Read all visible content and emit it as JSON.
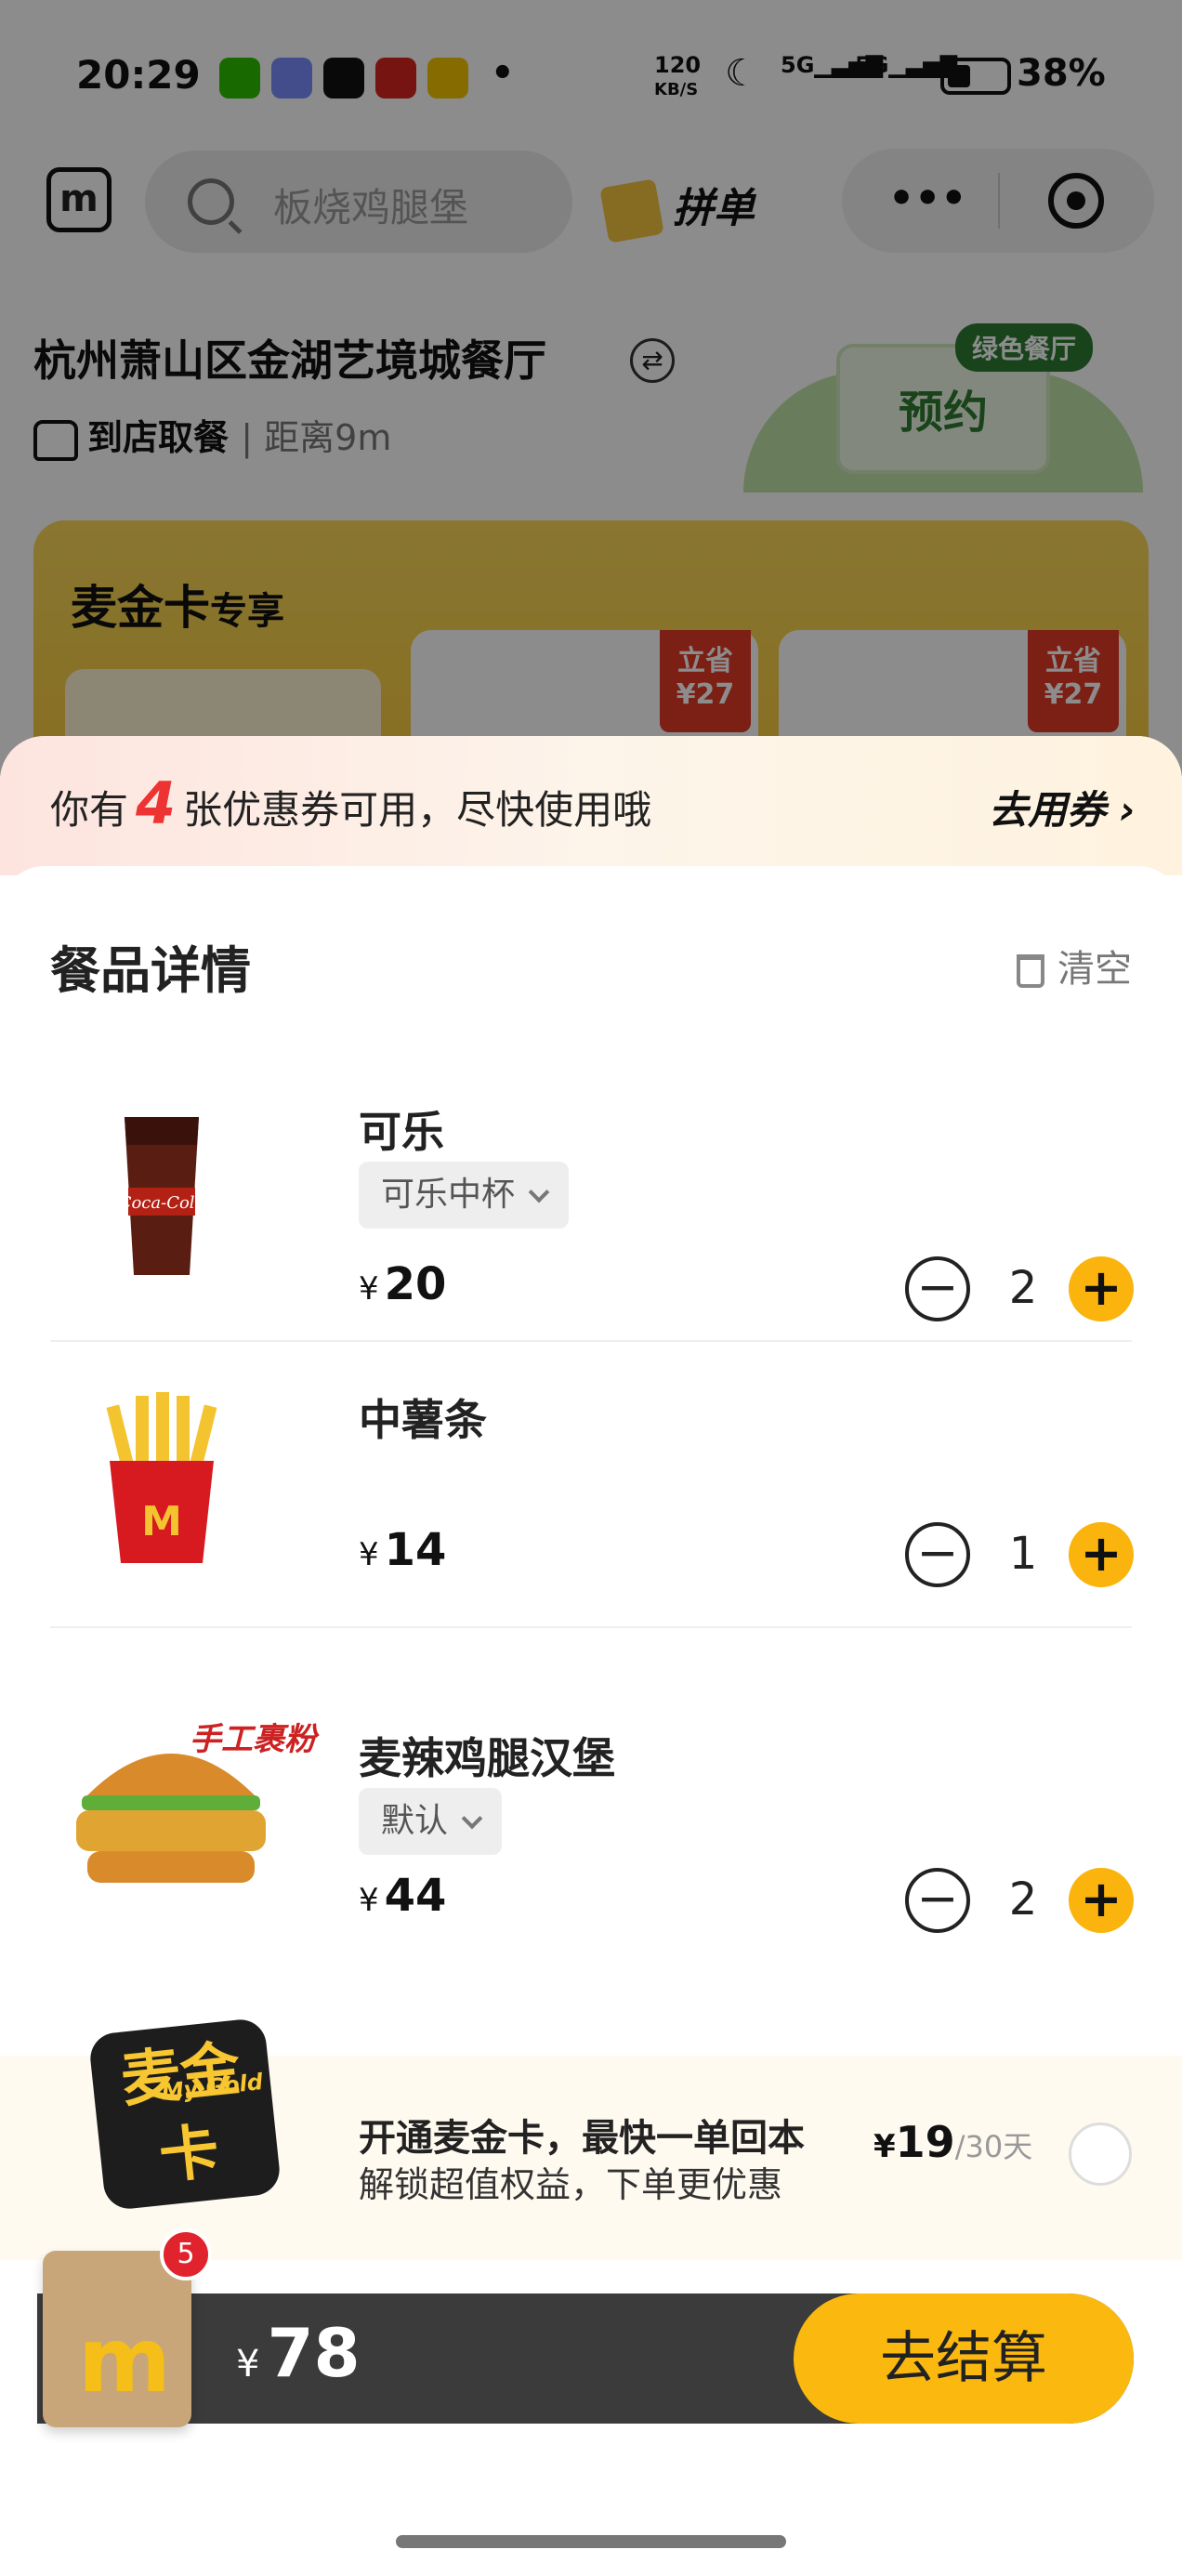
{
  "status_bar": {
    "time": "20:29",
    "net_speed": "120",
    "net_unit": "KB/S",
    "sig1": "5G",
    "sig2": "5G",
    "battery": "38%"
  },
  "nav": {
    "search_placeholder": "板烧鸡腿堡",
    "pindan": "拼单",
    "menu_dots": "•••"
  },
  "store": {
    "name": "杭州萧山区金湖艺境城餐厅",
    "mode": "到店取餐",
    "distance": "距离9m",
    "reserve": "预约",
    "green_tag": "绿色餐厅"
  },
  "gold_section": {
    "title": "麦金卡",
    "title_suffix": "专享",
    "deal1_save": "立省¥27",
    "deal2_save": "立省¥27"
  },
  "coupon_banner": {
    "prefix": "你有",
    "count": "4",
    "suffix": "张优惠券可用，尽快使用哦",
    "action": "去用券 ›"
  },
  "order": {
    "title": "餐品详情",
    "clear": "清空",
    "items": [
      {
        "name": "可乐",
        "spec": "可乐中杯",
        "price": "20",
        "qty": "2"
      },
      {
        "name": "中薯条",
        "price": "14",
        "qty": "1"
      },
      {
        "name": "麦辣鸡腿汉堡",
        "spec": "默认",
        "price": "44",
        "qty": "2",
        "badge": "手工裹粉"
      }
    ]
  },
  "promo": {
    "badge_big": "麦金卡",
    "badge_small": "My Gold",
    "line1": "开通麦金卡，最快一单回本",
    "line2": "解锁超值权益，下单更优惠",
    "price": "19",
    "period": "/30天"
  },
  "cart": {
    "count": "5",
    "total": "78",
    "checkout": "去结算"
  },
  "currency": "¥",
  "colors": {
    "accent": "#fbb30d",
    "brand_red": "#e0232c"
  }
}
